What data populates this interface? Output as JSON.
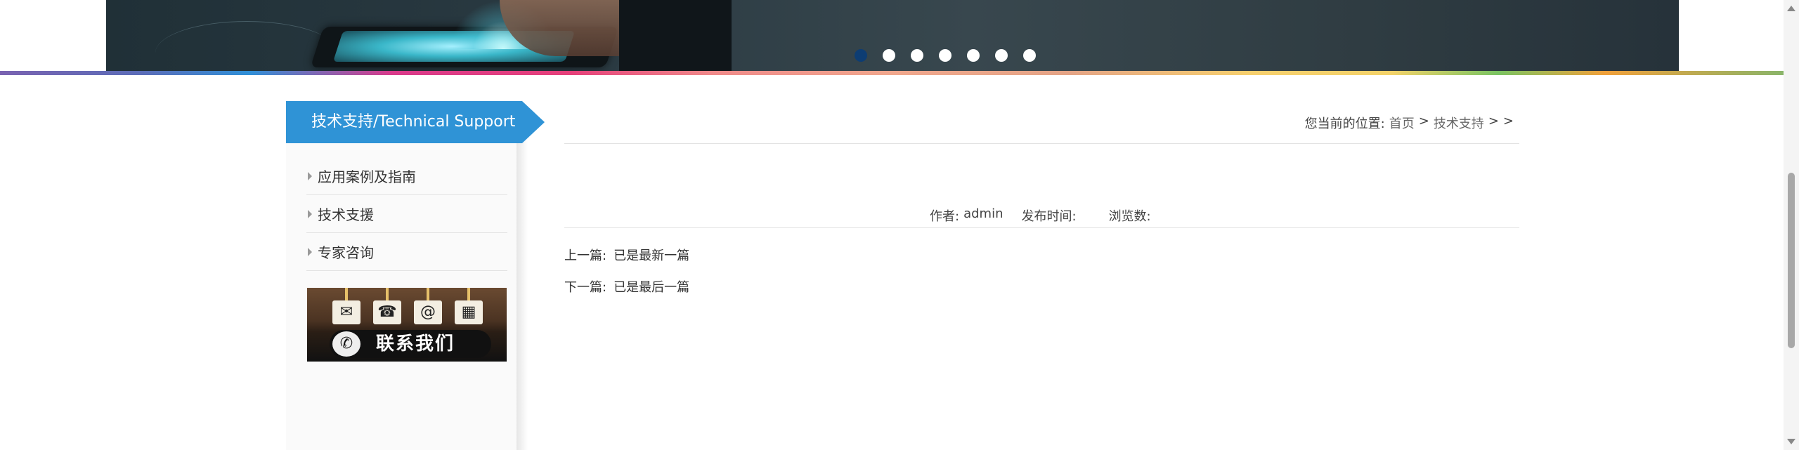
{
  "banner": {
    "slide_count": 7,
    "active_index": 0,
    "active_color": "#0d3d73"
  },
  "sidebar": {
    "title": "技术支持/Technical Support",
    "items": [
      {
        "label": "应用案例及指南"
      },
      {
        "label": "技术支援"
      },
      {
        "label": "专家咨询"
      }
    ],
    "contact_label": "联系我们",
    "accent_color": "#2f93d6"
  },
  "breadcrumb": {
    "prefix": "您当前的位置:",
    "home": "首页",
    "sep1": ">",
    "section": "技术支持",
    "sep2": ">",
    "sep3": ">"
  },
  "article": {
    "author_label": "作者:",
    "author": "admin",
    "publish_label": "发布时间:",
    "views_label": "浏览数:",
    "prev_label": "上一篇:",
    "prev_value": "已是最新一篇",
    "next_label": "下一篇:",
    "next_value": "已是最后一篇"
  }
}
